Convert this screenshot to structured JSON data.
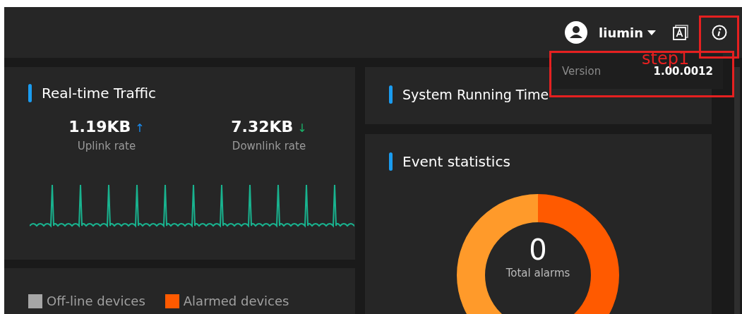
{
  "header": {
    "user": {
      "name": "liumin"
    }
  },
  "version_popover": {
    "label": "Version",
    "value": "1.00.0012"
  },
  "annotation": {
    "label": "step1"
  },
  "traffic": {
    "title": "Real-time Traffic",
    "rates": [
      {
        "kind": "up",
        "value": "1.19KB",
        "arrow": "↑",
        "label": "Uplink rate"
      },
      {
        "kind": "down",
        "value": "7.32KB",
        "arrow": "↓",
        "label": "Downlink rate"
      }
    ]
  },
  "devices_legend": [
    {
      "label": "Off-line devices",
      "color": "#a6a6a6"
    },
    {
      "label": "Alarmed devices",
      "color": "#ff5a00"
    }
  ],
  "running_time": {
    "title": "System Running Time"
  },
  "events": {
    "title": "Event statistics",
    "total": "0",
    "total_label": "Total alarms"
  }
}
